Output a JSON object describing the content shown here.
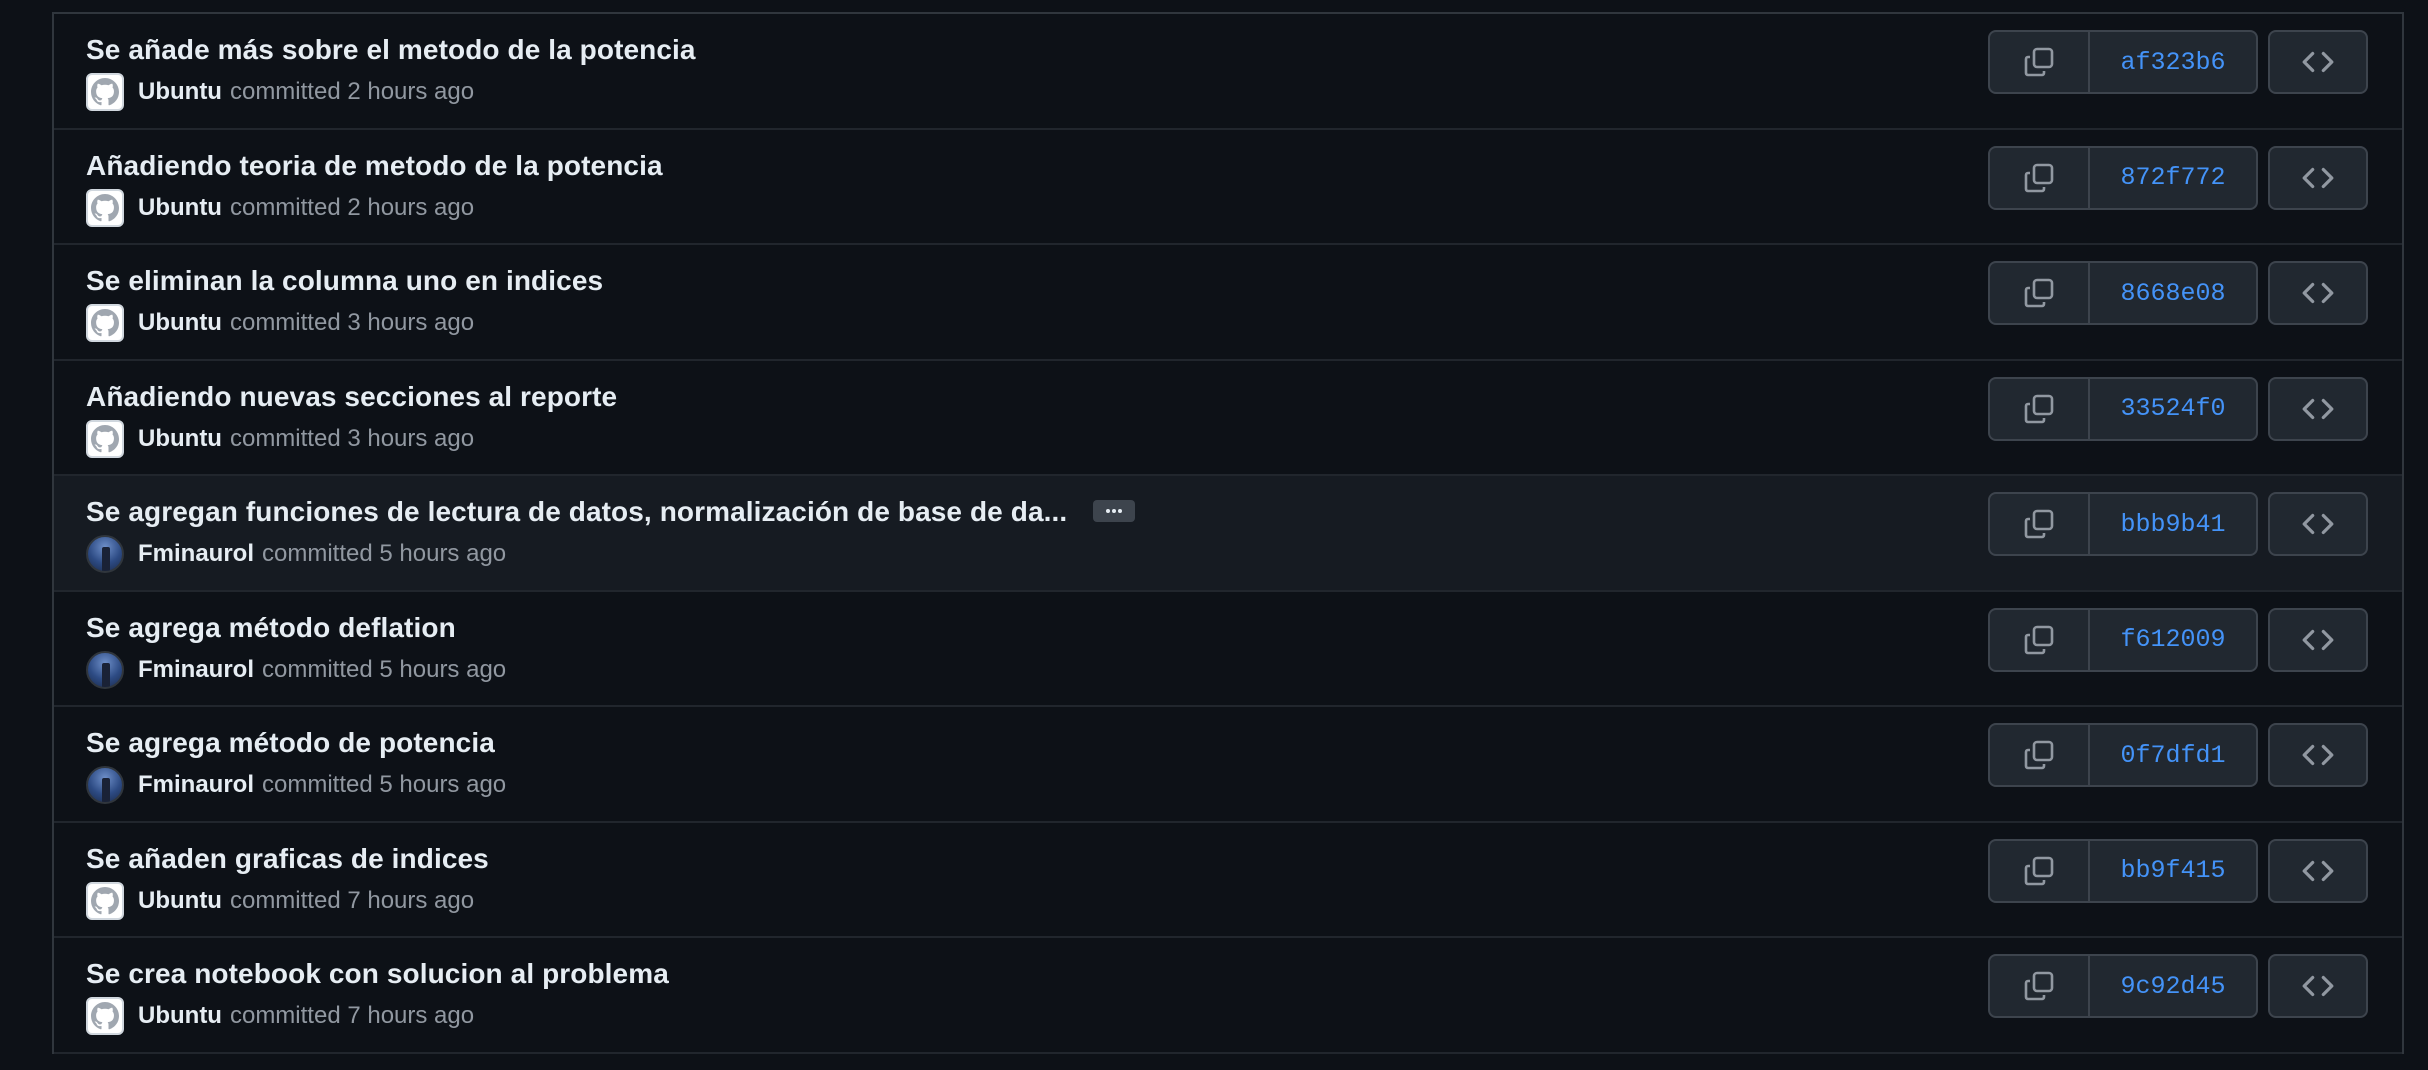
{
  "commits": [
    {
      "title": "Se añade más sobre el metodo de la potencia",
      "author": "Ubuntu",
      "time": "committed 2 hours ago",
      "sha": "af323b6",
      "avatar": "github-default-avatar"
    },
    {
      "title": "Añadiendo teoria de metodo de la potencia",
      "author": "Ubuntu",
      "time": "committed 2 hours ago",
      "sha": "872f772",
      "avatar": "github-default-avatar"
    },
    {
      "title": "Se eliminan la columna uno en indices",
      "author": "Ubuntu",
      "time": "committed 3 hours ago",
      "sha": "8668e08",
      "avatar": "github-default-avatar"
    },
    {
      "title": "Añadiendo nuevas secciones al reporte",
      "author": "Ubuntu",
      "time": "committed 3 hours ago",
      "sha": "33524f0",
      "avatar": "github-default-avatar"
    },
    {
      "title": "Se agregan funciones de lectura de datos, normalización de base de da...",
      "author": "Fminaurol",
      "time": "committed 5 hours ago",
      "sha": "bbb9b41",
      "avatar": "user-photo-avatar",
      "truncated": true,
      "hover": true
    },
    {
      "title": "Se agrega método deflation",
      "author": "Fminaurol",
      "time": "committed 5 hours ago",
      "sha": "f612009",
      "avatar": "user-photo-avatar"
    },
    {
      "title": "Se agrega método de potencia",
      "author": "Fminaurol",
      "time": "committed 5 hours ago",
      "sha": "0f7dfd1",
      "avatar": "user-photo-avatar"
    },
    {
      "title": "Se añaden graficas de indices",
      "author": "Ubuntu",
      "time": "committed 7 hours ago",
      "sha": "bb9f415",
      "avatar": "github-default-avatar"
    },
    {
      "title": "Se crea notebook con solucion al problema",
      "author": "Ubuntu",
      "time": "committed 7 hours ago",
      "sha": "9c92d45",
      "avatar": "github-default-avatar"
    }
  ],
  "icons": {
    "copy": "copy-icon",
    "browse": "code-brackets-icon",
    "more": "ellipsis-icon"
  },
  "colors": {
    "background": "#0d1117",
    "title": "#e6edf3",
    "meta": "#9198a1",
    "sha": "#4493f8",
    "button_bg": "#212830",
    "button_border": "#3d444d"
  }
}
